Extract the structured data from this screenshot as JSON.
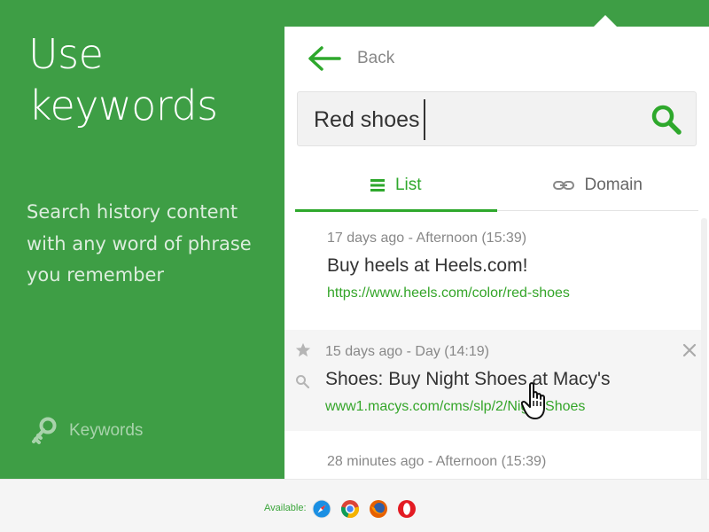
{
  "left": {
    "title_line1": "Use",
    "title_line2": "keywords",
    "desc_line1": "Search history content",
    "desc_line2": "with any word of phrase",
    "desc_line3": "you remember",
    "feature_label": "Keywords",
    "feature_icon": "key-icon"
  },
  "panel": {
    "back_label": "Back",
    "search_value": "Red shoes",
    "tabs": [
      {
        "label": "List",
        "icon": "list-icon",
        "active": true
      },
      {
        "label": "Domain",
        "icon": "link-icon",
        "active": false
      }
    ],
    "items": [
      {
        "meta": "17 days ago - Afternoon (15:39)",
        "title": "Buy heels at Heels.com!",
        "url": "https://www.heels.com/color/red-shoes"
      },
      {
        "meta": "15 days ago - Day (14:19)",
        "title": "Shoes: Buy Night Shoes at Macy's",
        "url": "www1.macys.com/cms/slp/2/Night-Shoes"
      },
      {
        "meta": "28 minutes ago - Afternoon (15:39)"
      }
    ]
  },
  "footer": {
    "available_label": "Available:",
    "browsers": [
      "safari-icon",
      "chrome-icon",
      "firefox-icon",
      "opera-icon"
    ]
  },
  "colors": {
    "brand_green": "#3e9e45",
    "accent_green": "#2ea82c",
    "url_green": "#34a529"
  }
}
